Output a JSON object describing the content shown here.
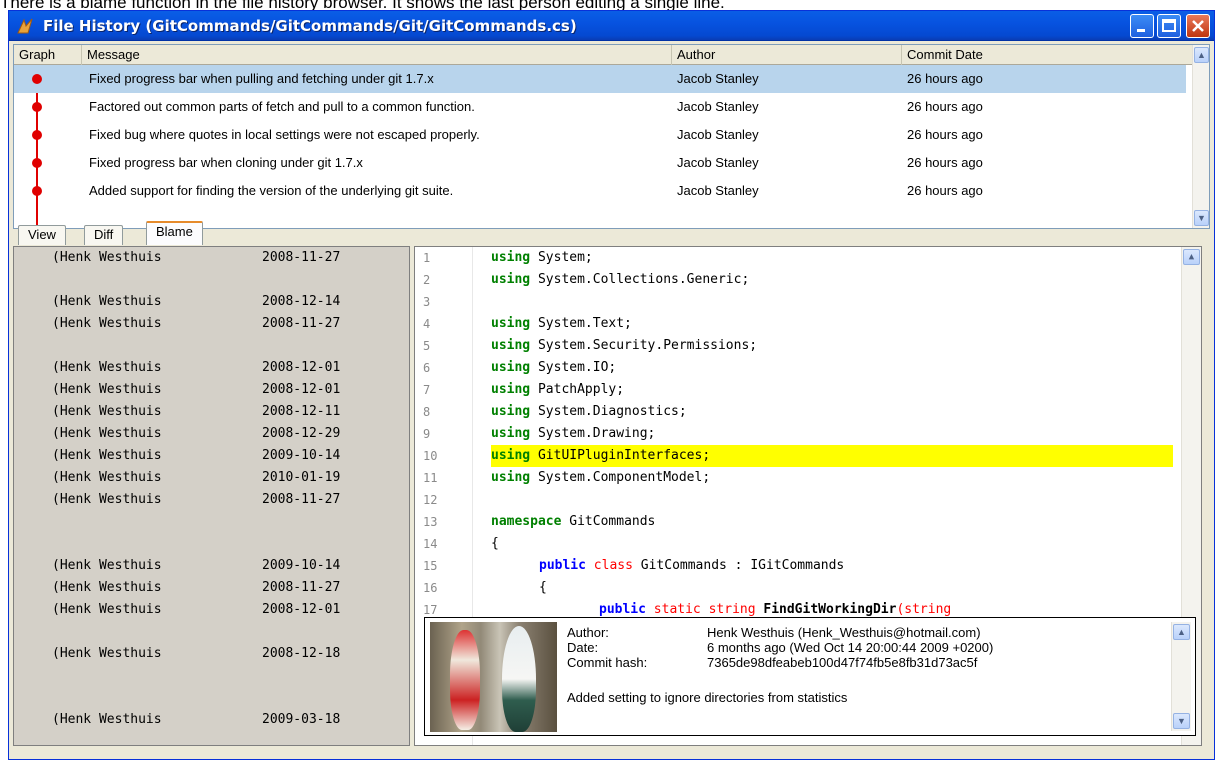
{
  "caption": "There is a blame function in the file history browser. It shows the last person editing a single line.",
  "window": {
    "title": "File History (GitCommands/GitCommands/Git/GitCommands.cs)"
  },
  "history": {
    "columns": [
      "Graph",
      "Message",
      "Author",
      "Commit Date"
    ],
    "rows": [
      {
        "message": "Fixed progress bar when pulling and fetching under git 1.7.x",
        "author": "Jacob Stanley",
        "date": "26 hours ago"
      },
      {
        "message": "Factored out common parts of fetch and pull to a common function.",
        "author": "Jacob Stanley",
        "date": "26 hours ago"
      },
      {
        "message": "Fixed bug where quotes in local settings were not escaped properly.",
        "author": "Jacob Stanley",
        "date": "26 hours ago"
      },
      {
        "message": "Fixed progress bar when cloning under git 1.7.x",
        "author": "Jacob Stanley",
        "date": "26 hours ago"
      },
      {
        "message": "Added support for finding the version of the underlying git suite.",
        "author": "Jacob Stanley",
        "date": "26 hours ago"
      }
    ]
  },
  "tabs": [
    "View",
    "Diff",
    "Blame"
  ],
  "blame": {
    "lines": [
      {
        "author": "(Henk Westhuis",
        "date": "2008-11-27"
      },
      {
        "author": "",
        "date": ""
      },
      {
        "author": "(Henk Westhuis",
        "date": "2008-12-14"
      },
      {
        "author": "(Henk Westhuis",
        "date": "2008-11-27"
      },
      {
        "author": "",
        "date": ""
      },
      {
        "author": "(Henk Westhuis",
        "date": "2008-12-01"
      },
      {
        "author": "(Henk Westhuis",
        "date": "2008-12-01"
      },
      {
        "author": "(Henk Westhuis",
        "date": "2008-12-11"
      },
      {
        "author": "(Henk Westhuis",
        "date": "2008-12-29"
      },
      {
        "author": "(Henk Westhuis",
        "date": "2009-10-14"
      },
      {
        "author": "(Henk Westhuis",
        "date": "2010-01-19"
      },
      {
        "author": "(Henk Westhuis",
        "date": "2008-11-27"
      },
      {
        "author": "",
        "date": ""
      },
      {
        "author": "",
        "date": ""
      },
      {
        "author": "(Henk Westhuis",
        "date": "2009-10-14"
      },
      {
        "author": "(Henk Westhuis",
        "date": "2008-11-27"
      },
      {
        "author": "(Henk Westhuis",
        "date": "2008-12-01"
      },
      {
        "author": "",
        "date": ""
      },
      {
        "author": "(Henk Westhuis",
        "date": "2008-12-18"
      },
      {
        "author": "",
        "date": ""
      },
      {
        "author": "",
        "date": ""
      },
      {
        "author": "(Henk Westhuis",
        "date": "2009-03-18"
      }
    ]
  },
  "code": {
    "line_numbers": [
      "1",
      "2",
      "3",
      "4",
      "5",
      "6",
      "7",
      "8",
      "9",
      "10",
      "11",
      "12",
      "13",
      "14",
      "15",
      "16",
      "17"
    ],
    "highlighted_line": 10,
    "lines": [
      {
        "kw": "using",
        "rest": " System;"
      },
      {
        "kw": "using",
        "rest": " System.Collections.Generic;"
      },
      {
        "kw": "",
        "rest": ""
      },
      {
        "kw": "using",
        "rest": " System.Text;"
      },
      {
        "kw": "using",
        "rest": " System.Security.Permissions;"
      },
      {
        "kw": "using",
        "rest": " System.IO;"
      },
      {
        "kw": "using",
        "rest": " PatchApply;"
      },
      {
        "kw": "using",
        "rest": " System.Diagnostics;"
      },
      {
        "kw": "using",
        "rest": " System.Drawing;"
      },
      {
        "kw": "using",
        "rest": " GitUIPluginInterfaces;"
      },
      {
        "kw": "using",
        "rest": " System.ComponentModel;"
      },
      {
        "kw": "",
        "rest": ""
      },
      {
        "kw": "namespace",
        "rest": " GitCommands"
      },
      {
        "kw": "",
        "rest": "{"
      },
      {
        "kw": "public",
        "rest2": "class",
        "rest": " GitCommands : IGitCommands"
      },
      {
        "kw": "",
        "rest": "{"
      },
      {
        "kw": "public",
        "rest2": "static string",
        "ident": "FindGitWorkingDir",
        "rest": "(string"
      }
    ]
  },
  "commit_info": {
    "author_label": "Author:",
    "author_value": "Henk Westhuis (Henk_Westhuis@hotmail.com)",
    "date_label": "Date:",
    "date_value": "6 months ago (Wed Oct 14 20:00:44 2009 +0200)",
    "hash_label": "Commit hash:",
    "hash_value": "7365de98dfeabeb100d47f74fb5e8fb31d73ac5f",
    "message": "Added setting to ignore directories from statistics"
  },
  "colors": {
    "title_blue": "#0753e0",
    "graph_red": "#e00000",
    "selection": "#b8d4ec",
    "highlight": "#ffff00",
    "keyword_green": "#008000",
    "keyword_blue": "#0000ff"
  }
}
